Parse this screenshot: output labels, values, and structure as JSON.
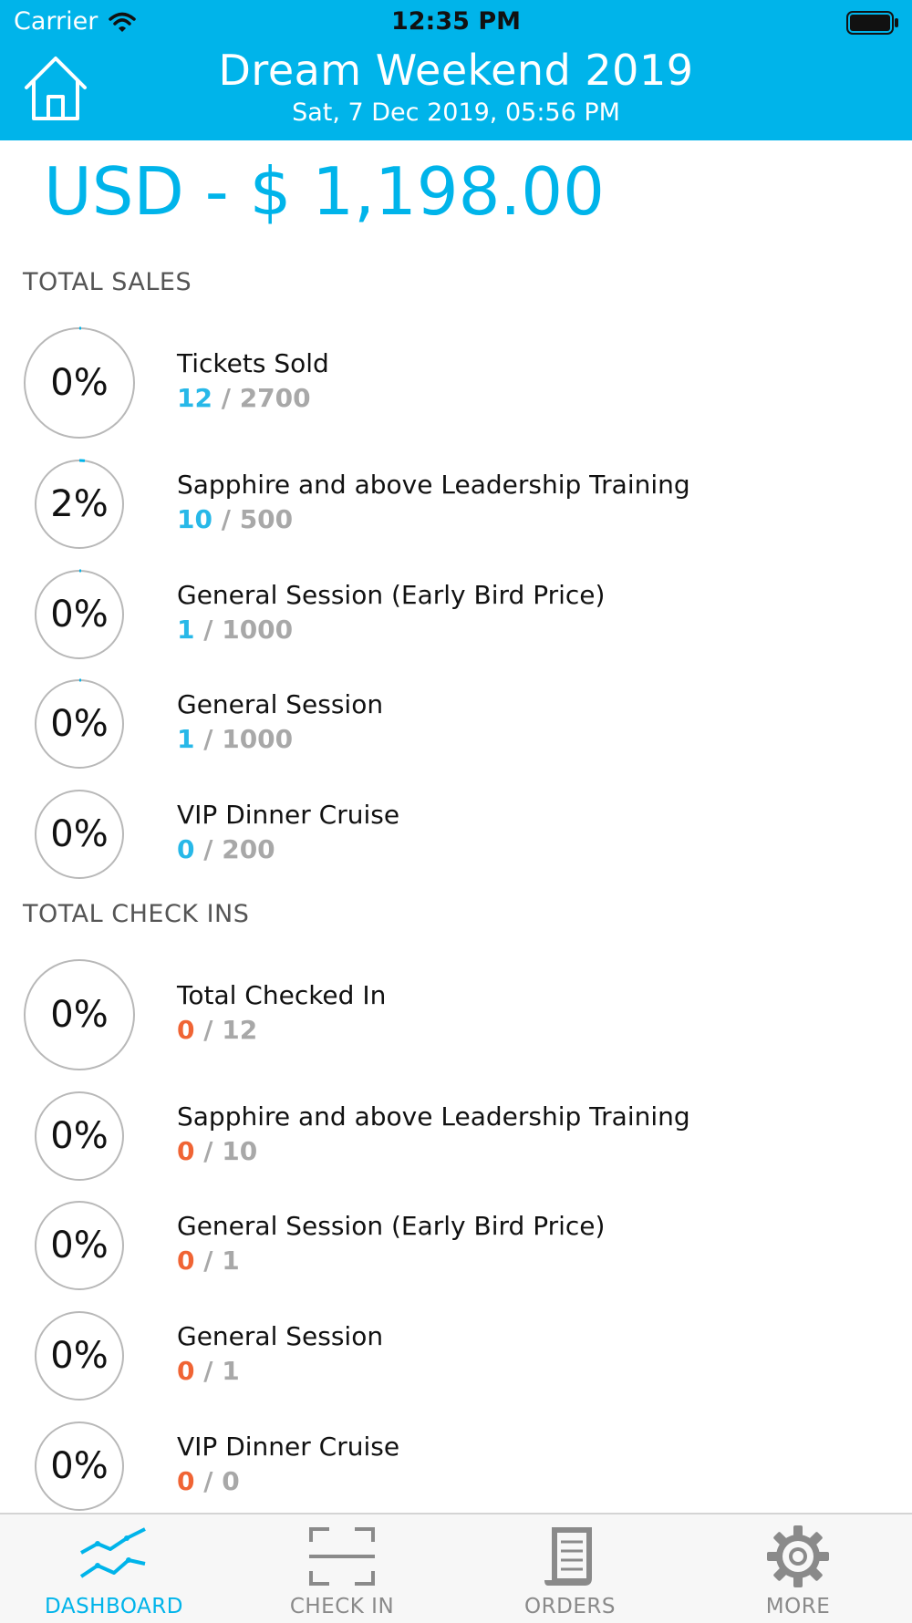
{
  "status_bar": {
    "carrier": "Carrier",
    "time": "12:35 PM"
  },
  "header": {
    "title": "Dream Weekend 2019",
    "date": "Sat, 7 Dec 2019, 05:56 PM",
    "home_icon": "home-icon"
  },
  "amount": "USD - $ 1,198.00",
  "colors": {
    "accent": "#00b4ea",
    "sales_count": "#27b8e8",
    "checkin_count": "#f06434",
    "muted": "#a8a8a8"
  },
  "sales": {
    "title": "TOTAL SALES",
    "items": [
      {
        "percent_label": "0%",
        "name": "Tickets Sold",
        "count": "12",
        "sep": " / ",
        "total": "2700",
        "fraction": 0.0044
      },
      {
        "percent_label": "2%",
        "name": "Sapphire and above Leadership Training",
        "count": "10",
        "sep": " / ",
        "total": "500",
        "fraction": 0.02
      },
      {
        "percent_label": "0%",
        "name": "General Session (Early Bird Price)",
        "count": "1",
        "sep": " / ",
        "total": "1000",
        "fraction": 0.001
      },
      {
        "percent_label": "0%",
        "name": "General Session",
        "count": "1",
        "sep": " / ",
        "total": "1000",
        "fraction": 0.001
      },
      {
        "percent_label": "0%",
        "name": "VIP Dinner Cruise",
        "count": "0",
        "sep": " / ",
        "total": "200",
        "fraction": 0
      }
    ]
  },
  "checkins": {
    "title": "TOTAL CHECK INS",
    "items": [
      {
        "percent_label": "0%",
        "name": "Total Checked In",
        "count": "0",
        "sep": " / ",
        "total": "12",
        "fraction": 0
      },
      {
        "percent_label": "0%",
        "name": "Sapphire and above Leadership Training",
        "count": "0",
        "sep": " / ",
        "total": "10",
        "fraction": 0
      },
      {
        "percent_label": "0%",
        "name": "General Session (Early Bird Price)",
        "count": "0",
        "sep": " / ",
        "total": "1",
        "fraction": 0
      },
      {
        "percent_label": "0%",
        "name": "General Session",
        "count": "0",
        "sep": " / ",
        "total": "1",
        "fraction": 0
      },
      {
        "percent_label": "0%",
        "name": "VIP Dinner Cruise",
        "count": "0",
        "sep": " / ",
        "total": "0",
        "fraction": 0
      }
    ]
  },
  "tabs": [
    {
      "label": "DASHBOARD",
      "icon": "dashboard-chart-icon",
      "active": true
    },
    {
      "label": "CHECK IN",
      "icon": "scan-frame-icon",
      "active": false
    },
    {
      "label": "ORDERS",
      "icon": "receipt-icon",
      "active": false
    },
    {
      "label": "MORE",
      "icon": "gear-icon",
      "active": false
    }
  ]
}
